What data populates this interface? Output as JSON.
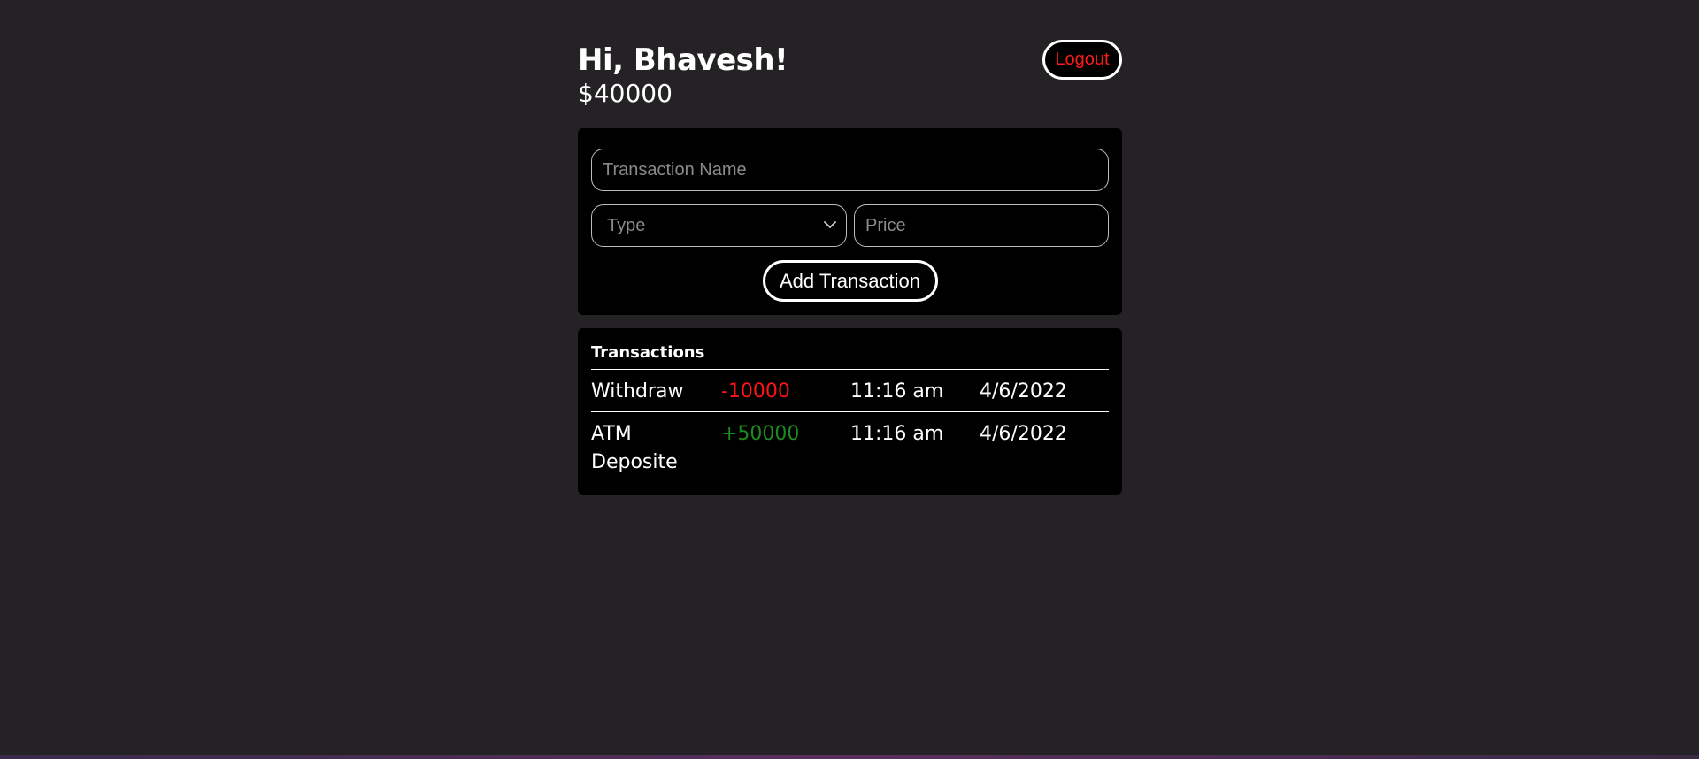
{
  "header": {
    "greeting": "Hi, Bhavesh!",
    "balance": "$40000",
    "logout_label": "Logout"
  },
  "form": {
    "name_placeholder": "Transaction Name",
    "type_placeholder": "Type",
    "price_placeholder": "Price",
    "submit_label": "Add Transaction"
  },
  "transactions": {
    "title": "Transactions",
    "rows": [
      {
        "name": "Withdraw",
        "amount": "-10000",
        "time": "11:16 am",
        "date": "4/6/2022"
      },
      {
        "name": "ATM Deposite",
        "amount": "+50000",
        "time": "11:16 am",
        "date": "4/6/2022"
      }
    ]
  },
  "colors": {
    "background": "#242224",
    "card": "#000000",
    "negative": "#ff1414",
    "positive": "#1d8a1d",
    "logout_text": "#ff1a1a"
  },
  "icons": {
    "select_arrow": "chevron-down-icon"
  }
}
